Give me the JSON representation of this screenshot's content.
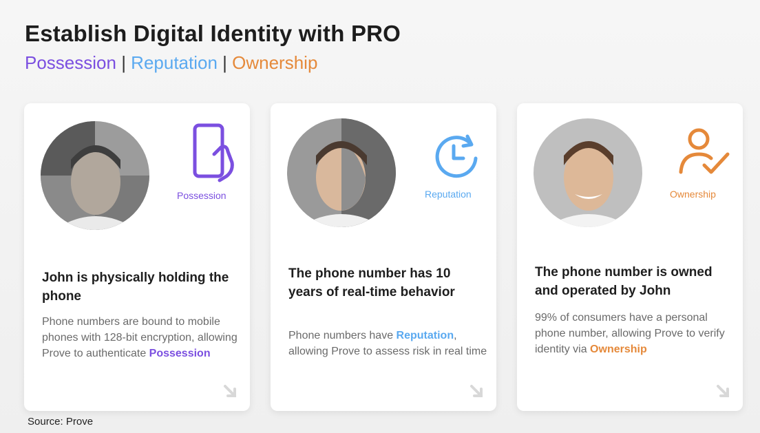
{
  "header": {
    "title": "Establish Digital Identity with PRO",
    "subtitle": {
      "possession": "Possession",
      "sep1": " | ",
      "reputation": "Reputation",
      "sep2": " | ",
      "ownership": "Ownership"
    }
  },
  "colors": {
    "possession": "#7b4fe0",
    "reputation": "#5aa9f0",
    "ownership": "#e5893a"
  },
  "cards": [
    {
      "icon": "phone-hand-icon",
      "icon_label": "Possession",
      "headline": "John is physically holding the phone",
      "body_pre": "Phone numbers are bound to mobile phones with 128-bit encryption, allowing Prove to authenticate ",
      "body_highlight": "Possession",
      "body_post": ""
    },
    {
      "icon": "clock-refresh-icon",
      "icon_label": "Reputation",
      "headline": "The phone number has 10 years of real-time behavior",
      "body_pre": "Phone numbers have ",
      "body_highlight": "Reputation",
      "body_post": ", allowing Prove to assess risk in real time"
    },
    {
      "icon": "person-check-icon",
      "icon_label": "Ownership",
      "headline": "The phone number is owned and operated by John",
      "body_pre": "99% of consumers have a personal phone number, allowing Prove to verify identity via ",
      "body_highlight": "Ownership",
      "body_post": ""
    }
  ],
  "footer": {
    "source": "Source: Prove"
  }
}
